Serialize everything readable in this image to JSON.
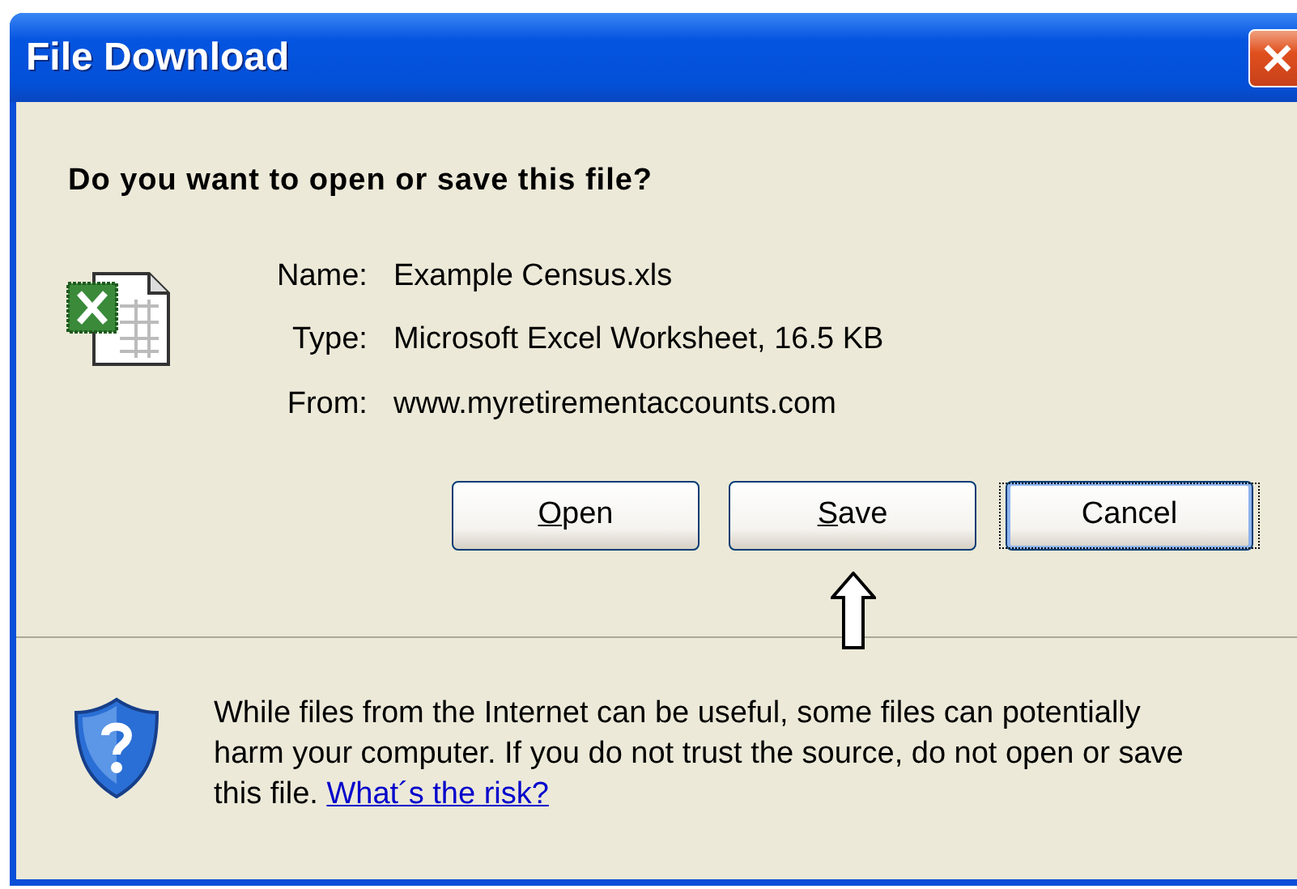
{
  "window": {
    "title": "File Download"
  },
  "question": "Do you want to open or save this file?",
  "file_details": [
    {
      "label": "Name:",
      "value": "Example Census.xls"
    },
    {
      "label": "Type:",
      "value": "Microsoft Excel Worksheet, 16.5 KB"
    },
    {
      "label": "From:",
      "value": "www.myretirementaccounts.com"
    }
  ],
  "buttons": [
    {
      "label": "Open",
      "first_letter_underlined": true,
      "focused": false,
      "pointed_at": false
    },
    {
      "label": "Save",
      "first_letter_underlined": true,
      "focused": false,
      "pointed_at": true
    },
    {
      "label": "Cancel",
      "first_letter_underlined": false,
      "focused": true,
      "pointed_at": false
    }
  ],
  "warning": {
    "text": "While files from the Internet can be useful, some files can potentially harm your computer. If you do not trust the source, do not open or save this file.",
    "link": "What´s the risk?"
  }
}
